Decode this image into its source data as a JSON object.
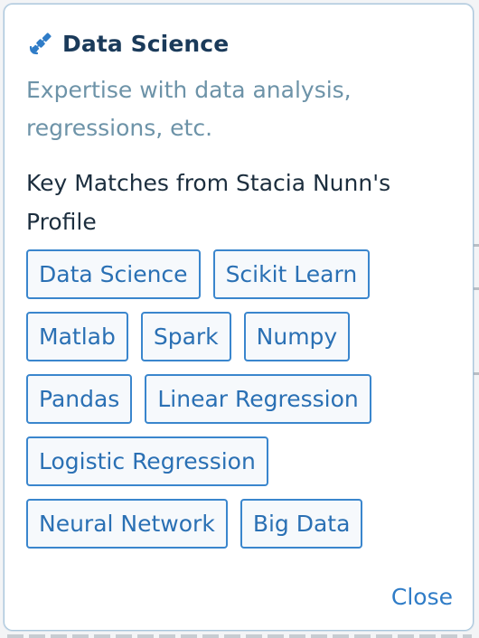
{
  "card": {
    "title": "Data Science",
    "icon": "satellite-icon",
    "description": "Expertise with data analysis, regressions, etc.",
    "matches_label": "Key Matches from Stacia Nunn's Profile",
    "tags": [
      "Data Science",
      "Scikit Learn",
      "Matlab",
      "Spark",
      "Numpy",
      "Pandas",
      "Linear Regression",
      "Logistic Regression",
      "Neural Network",
      "Big Data"
    ],
    "close_label": "Close"
  },
  "colors": {
    "title": "#1a3a5a",
    "description": "#6d93a8",
    "tag_border": "#3a86cd",
    "tag_text": "#2a70b4",
    "close": "#2f7cc7"
  }
}
